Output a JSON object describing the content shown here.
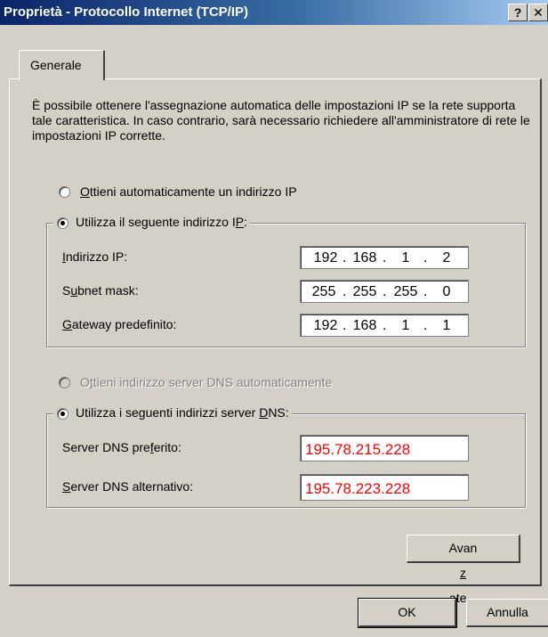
{
  "window": {
    "title": "Proprietà - Protocollo Internet (TCP/IP)",
    "help_button": "?",
    "close_button": "✕"
  },
  "tabs": [
    {
      "label": "Generale",
      "selected": true
    }
  ],
  "intro_text": "È possibile ottenere l'assegnazione automatica delle impostazioni IP se la rete supporta tale caratteristica. In caso contrario, sarà necessario richiedere all'amministratore di rete le impostazioni IP corrette.",
  "ip_mode": {
    "auto": {
      "pre": "",
      "key": "O",
      "post": "ttieni automaticamente un indirizzo IP",
      "checked": false
    },
    "manual": {
      "pre": "Utilizza il seguente indirizzo I",
      "key": "P",
      "post": ":",
      "checked": true
    }
  },
  "ip_fields": {
    "address": {
      "label_pre": "",
      "label_key": "I",
      "label_post": "ndirizzo IP:",
      "segments": [
        "192",
        "168",
        "1",
        "2"
      ]
    },
    "subnet": {
      "label_pre": "S",
      "label_key": "u",
      "label_post": "bnet mask:",
      "segments": [
        "255",
        "255",
        "255",
        "0"
      ]
    },
    "gateway": {
      "label_pre": "",
      "label_key": "G",
      "label_post": "ateway predefinito:",
      "segments": [
        "192",
        "168",
        "1",
        "1"
      ]
    }
  },
  "dns_mode": {
    "auto": {
      "pre": "O",
      "key": "t",
      "post": "tieni indirizzo server DNS automaticamente",
      "checked": false,
      "enabled": false
    },
    "manual": {
      "pre": "Utilizza i seguenti indirizzi server ",
      "key": "D",
      "post": "NS:",
      "checked": true
    }
  },
  "dns_fields": {
    "preferred": {
      "label_pre": "Server DNS pre",
      "label_key": "f",
      "label_post": "erito:",
      "value": "195.78.215.228"
    },
    "alternate": {
      "label_pre": "",
      "label_key": "S",
      "label_post": "erver DNS alternativo:",
      "value": "195.78.223.228"
    }
  },
  "buttons": {
    "advanced": {
      "pre": "Avan",
      "key": "z",
      "post": "ate..."
    },
    "ok": "OK",
    "cancel": "Annulla"
  },
  "colors": {
    "dns_value": "#ff0000",
    "titlebar": "#0a246a",
    "face": "#d4d0c8"
  }
}
